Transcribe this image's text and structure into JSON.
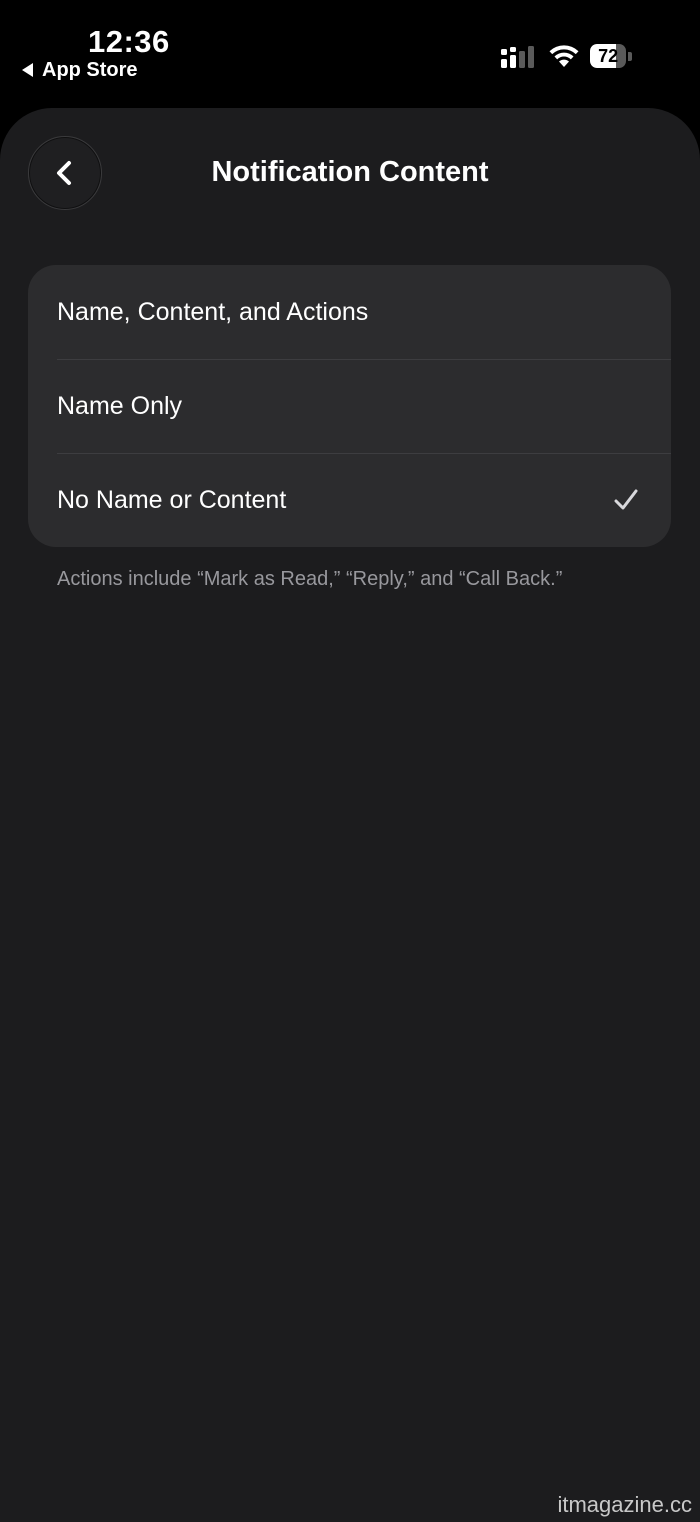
{
  "status_bar": {
    "time": "12:36",
    "back_app": "App Store",
    "battery_percent": 72
  },
  "nav": {
    "title": "Notification Content"
  },
  "options": [
    {
      "label": "Name, Content, and Actions",
      "selected": false
    },
    {
      "label": "Name Only",
      "selected": false
    },
    {
      "label": "No Name or Content",
      "selected": true
    }
  ],
  "footer_note": "Actions include “Mark as Read,” “Reply,” and “Call Back.”",
  "watermark": "itmagazine.cc",
  "colors": {
    "background": "#1c1c1e",
    "card": "#2c2c2e",
    "secondary_text": "#98989d"
  }
}
